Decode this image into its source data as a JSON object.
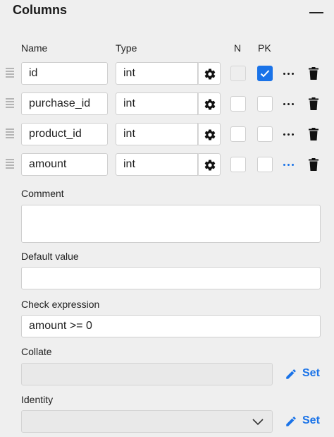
{
  "header": {
    "title": "Columns"
  },
  "columns_table": {
    "headers": {
      "name": "Name",
      "type": "Type",
      "n": "N",
      "pk": "PK"
    },
    "rows": [
      {
        "name": "id",
        "type": "int",
        "n": false,
        "n_disabled": true,
        "pk": true,
        "more_color": "#1a1a1a"
      },
      {
        "name": "purchase_id",
        "type": "int",
        "n": false,
        "n_disabled": false,
        "pk": false,
        "more_color": "#1a1a1a"
      },
      {
        "name": "product_id",
        "type": "int",
        "n": false,
        "n_disabled": false,
        "pk": false,
        "more_color": "#1a1a1a"
      },
      {
        "name": "amount",
        "type": "int",
        "n": false,
        "n_disabled": false,
        "pk": false,
        "more_color": "#1a73e8"
      }
    ]
  },
  "comment": {
    "label": "Comment",
    "value": ""
  },
  "default_value": {
    "label": "Default value",
    "value": ""
  },
  "check_expression": {
    "label": "Check expression",
    "value": "amount >= 0"
  },
  "collate": {
    "label": "Collate",
    "value": "",
    "set_label": "Set"
  },
  "identity": {
    "label": "Identity",
    "value": "",
    "set_label": "Set"
  },
  "colors": {
    "accent": "#1a73e8",
    "background": "#efefef"
  }
}
